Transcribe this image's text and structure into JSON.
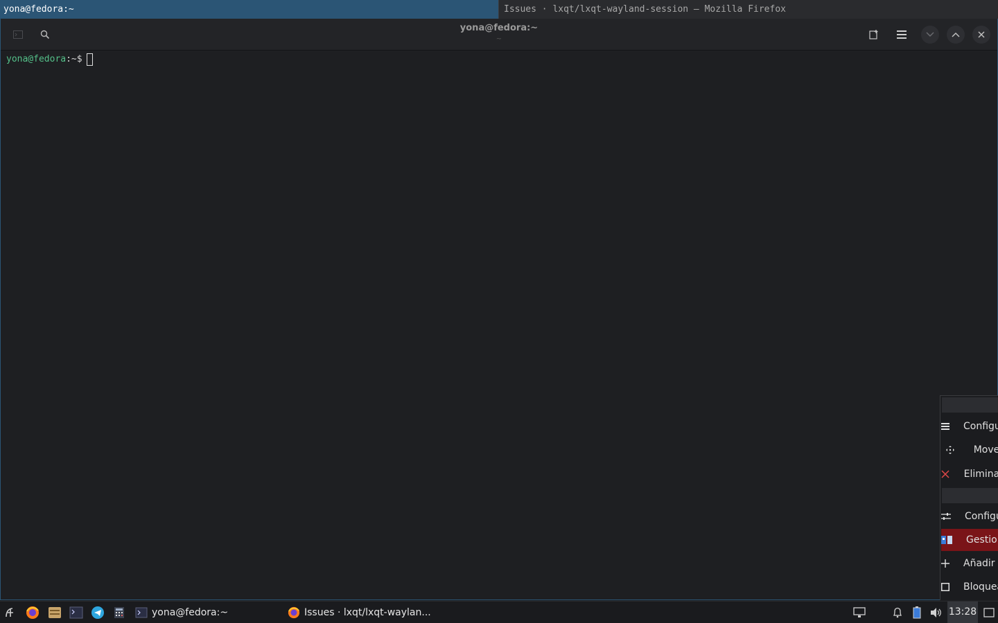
{
  "window_titles": {
    "active": "yona@fedora:~",
    "other": "Issues · lxqt/lxqt-wayland-session — Mozilla Firefox"
  },
  "terminal": {
    "title": "yona@fedora:~",
    "subtitle": "~",
    "prompt_user_host": "yona@fedora",
    "prompt_path": ":~$",
    "colors": {
      "prompt": "#54c089",
      "accent": "#2b5575"
    }
  },
  "header_icons": {
    "left": [
      "new-tab-icon",
      "search-icon"
    ],
    "right": [
      "split-view-icon",
      "hamburger-menu-icon",
      "minimize-icon",
      "maximize-icon",
      "close-icon"
    ]
  },
  "context_menu": {
    "items": [
      {
        "label": "Configurar",
        "icon": "menu-lines-icon"
      },
      {
        "label": "Mover",
        "icon": "move-icon"
      },
      {
        "label": "Eliminar",
        "icon": "delete-x-icon"
      },
      {
        "label": "Configurar panel",
        "icon": "sliders-icon"
      },
      {
        "label": "Gestionar widgets",
        "icon": "widgets-icon",
        "highlighted": true
      },
      {
        "label": "Añadir panel",
        "icon": "plus-icon"
      },
      {
        "label": "Bloquear",
        "icon": "square-icon"
      }
    ],
    "highlight_color": "#7a1418"
  },
  "taskbar": {
    "launchers": [
      "fedora-menu-icon",
      "firefox-icon",
      "file-manager-icon",
      "terminal-icon",
      "telegram-icon",
      "calculator-icon"
    ],
    "tasks": [
      {
        "label": "yona@fedora:~",
        "icon": "terminal-icon"
      },
      {
        "label": "Issues · lxqt/lxqt-waylan...",
        "icon": "firefox-icon"
      }
    ],
    "tray": [
      "network-icon",
      "notification-bell-icon",
      "battery-icon",
      "volume-icon"
    ],
    "clock": "13:28",
    "show_desktop_icon": "show-desktop-icon"
  }
}
